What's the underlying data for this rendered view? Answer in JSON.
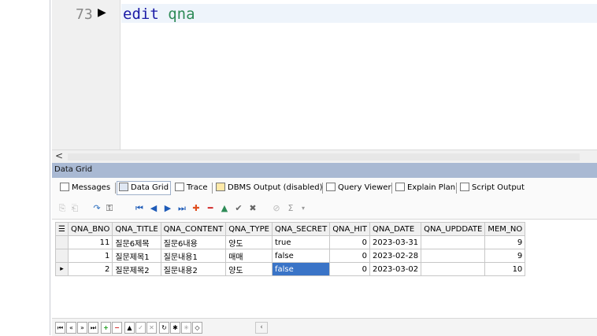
{
  "editor": {
    "line_number": "73",
    "code_keyword": "edit",
    "code_identifier": "qna"
  },
  "panel": {
    "title": "Data Grid"
  },
  "tabs": [
    {
      "label": "Messages",
      "icon": "messages-icon"
    },
    {
      "label": "Data Grid",
      "icon": "data-grid-icon",
      "active": true
    },
    {
      "label": "Trace",
      "icon": "trace-icon"
    },
    {
      "label": "DBMS Output (disabled)",
      "icon": "dbms-output-icon"
    },
    {
      "label": "Query Viewer",
      "icon": "query-viewer-icon"
    },
    {
      "label": "Explain Plan",
      "icon": "explain-plan-icon"
    },
    {
      "label": "Script Output",
      "icon": "script-output-icon"
    }
  ],
  "grid": {
    "columns": [
      "QNA_BNO",
      "QNA_TITLE",
      "QNA_CONTENT",
      "QNA_TYPE",
      "QNA_SECRET",
      "QNA_HIT",
      "QNA_DATE",
      "QNA_UPDDATE",
      "MEM_NO"
    ],
    "rows": [
      [
        "11",
        "질문6제목",
        "질문6내용",
        "양도",
        "true",
        "0",
        "2023-03-31",
        "",
        "9"
      ],
      [
        "1",
        "질문제목1",
        "질문내용1",
        "매매",
        "false",
        "0",
        "2023-02-28",
        "",
        "9"
      ],
      [
        "2",
        "질문제목2",
        "질문내용2",
        "양도",
        "false",
        "0",
        "2023-03-02",
        "",
        "10"
      ]
    ]
  },
  "colors": {
    "panel_title_bg": "#a9b9d3",
    "selection": "#3a74c7",
    "keyword": "#1a1aa6",
    "identifier": "#2e8b57"
  }
}
